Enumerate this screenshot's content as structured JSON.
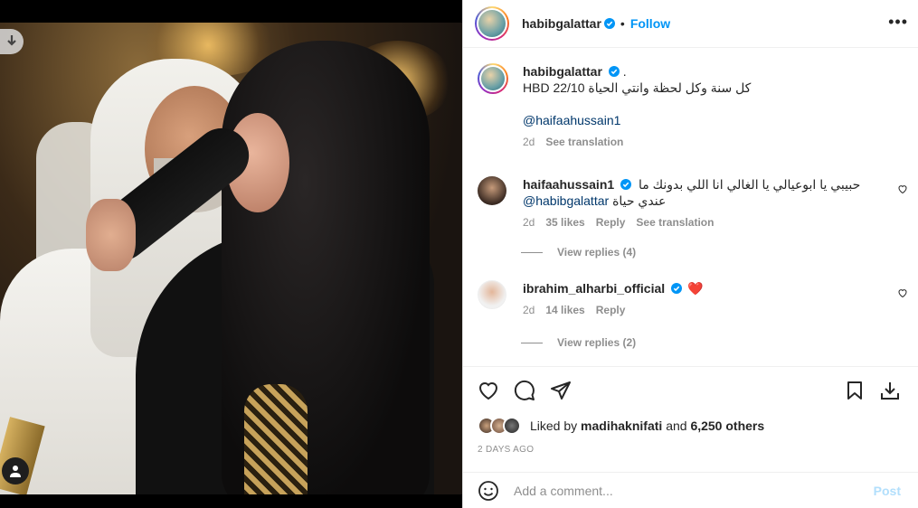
{
  "post": {
    "username": "habibgalattar",
    "follow_label": "Follow",
    "dot": "•",
    "more": "•••"
  },
  "caption": {
    "username": "habibgalattar",
    "text_suffix": ".",
    "line1": "HBD كل سنة وكل لحظة وانتي الحياة 22/10",
    "mention": "@haifaahussain1",
    "time": "2d",
    "see_translation": "See translation"
  },
  "comments": [
    {
      "username": "haifaahussain1",
      "text_rtl": "حبيبي يا ابوعيالي يا الغالي انا اللي بدونك ما",
      "mention": "@habibgalattar",
      "text_rtl2": "عندي حياة",
      "time": "2d",
      "likes": "35 likes",
      "reply": "Reply",
      "see_translation": "See translation",
      "view_replies": "View replies (4)"
    },
    {
      "username": "ibrahim_alharbi_official",
      "emoji": "❤️",
      "time": "2d",
      "likes": "14 likes",
      "reply": "Reply",
      "view_replies": "View replies (2)"
    }
  ],
  "likes_summary": {
    "prefix": "Liked by",
    "user": "madihaknifati",
    "and": "and",
    "others": "6,250 others"
  },
  "posted_ago": "2 DAYS AGO",
  "add_comment": {
    "placeholder": "Add a comment...",
    "post_label": "Post"
  },
  "colors": {
    "accent": "#0095f6",
    "verified": "#0095f6",
    "heart": "#ed4956"
  },
  "icons": [
    "download-icon",
    "tag-icon",
    "verified-icon",
    "more-icon",
    "heart-icon",
    "comment-icon",
    "share-icon",
    "save-icon",
    "download-icon",
    "emoji-icon"
  ]
}
